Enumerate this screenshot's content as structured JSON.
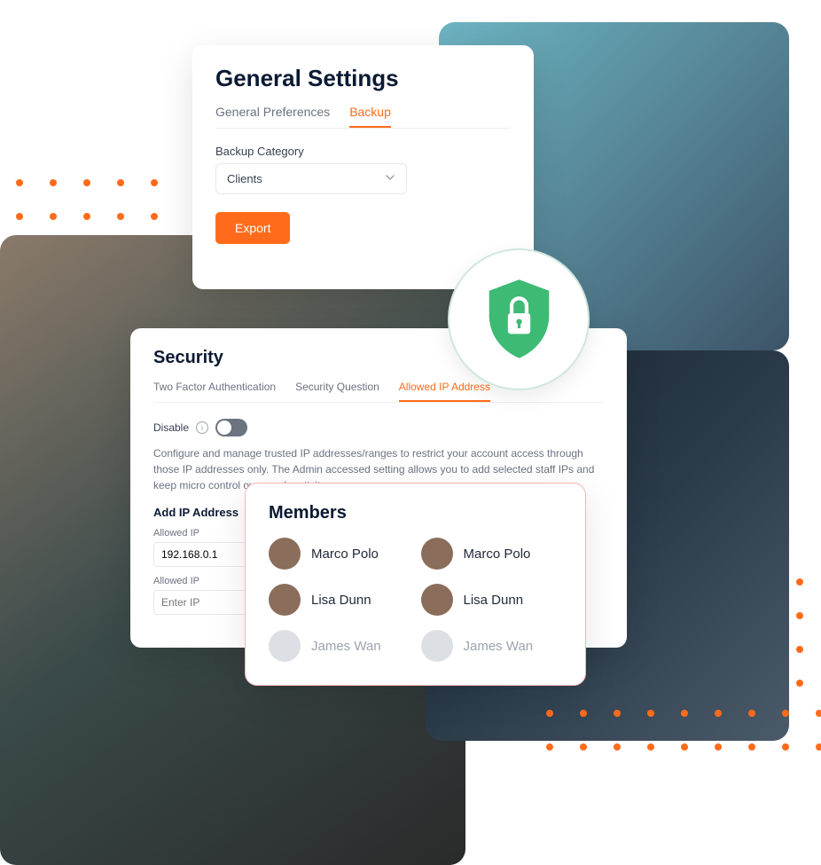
{
  "settings": {
    "title": "General Settings",
    "tabs": [
      "General Preferences",
      "Backup"
    ],
    "active_tab": 1,
    "category_label": "Backup Category",
    "category_value": "Clients",
    "export_label": "Export"
  },
  "security": {
    "title": "Security",
    "tabs": [
      "Two Factor Authentication",
      "Security Question",
      "Allowed IP Address"
    ],
    "active_tab": 2,
    "disable_label": "Disable",
    "description": "Configure and manage trusted IP addresses/ranges to restrict your account access through those IP addresses only. The Admin accessed setting allows you to add selected staff IPs and keep micro control over each activity.",
    "add_ip_heading": "Add IP Address",
    "ip_label": "Allowed IP",
    "ip_value_1": "192.168.0.1",
    "ip_placeholder": "Enter IP"
  },
  "members": {
    "title": "Members",
    "list": [
      {
        "name": "Marco Polo",
        "dim": false
      },
      {
        "name": "Marco Polo",
        "dim": false
      },
      {
        "name": "Lisa Dunn",
        "dim": false
      },
      {
        "name": "Lisa Dunn",
        "dim": false
      },
      {
        "name": "James Wan",
        "dim": true
      },
      {
        "name": "James Wan",
        "dim": true
      }
    ]
  },
  "colors": {
    "accent": "#ff6b1a",
    "shield": "#3dbb74"
  }
}
